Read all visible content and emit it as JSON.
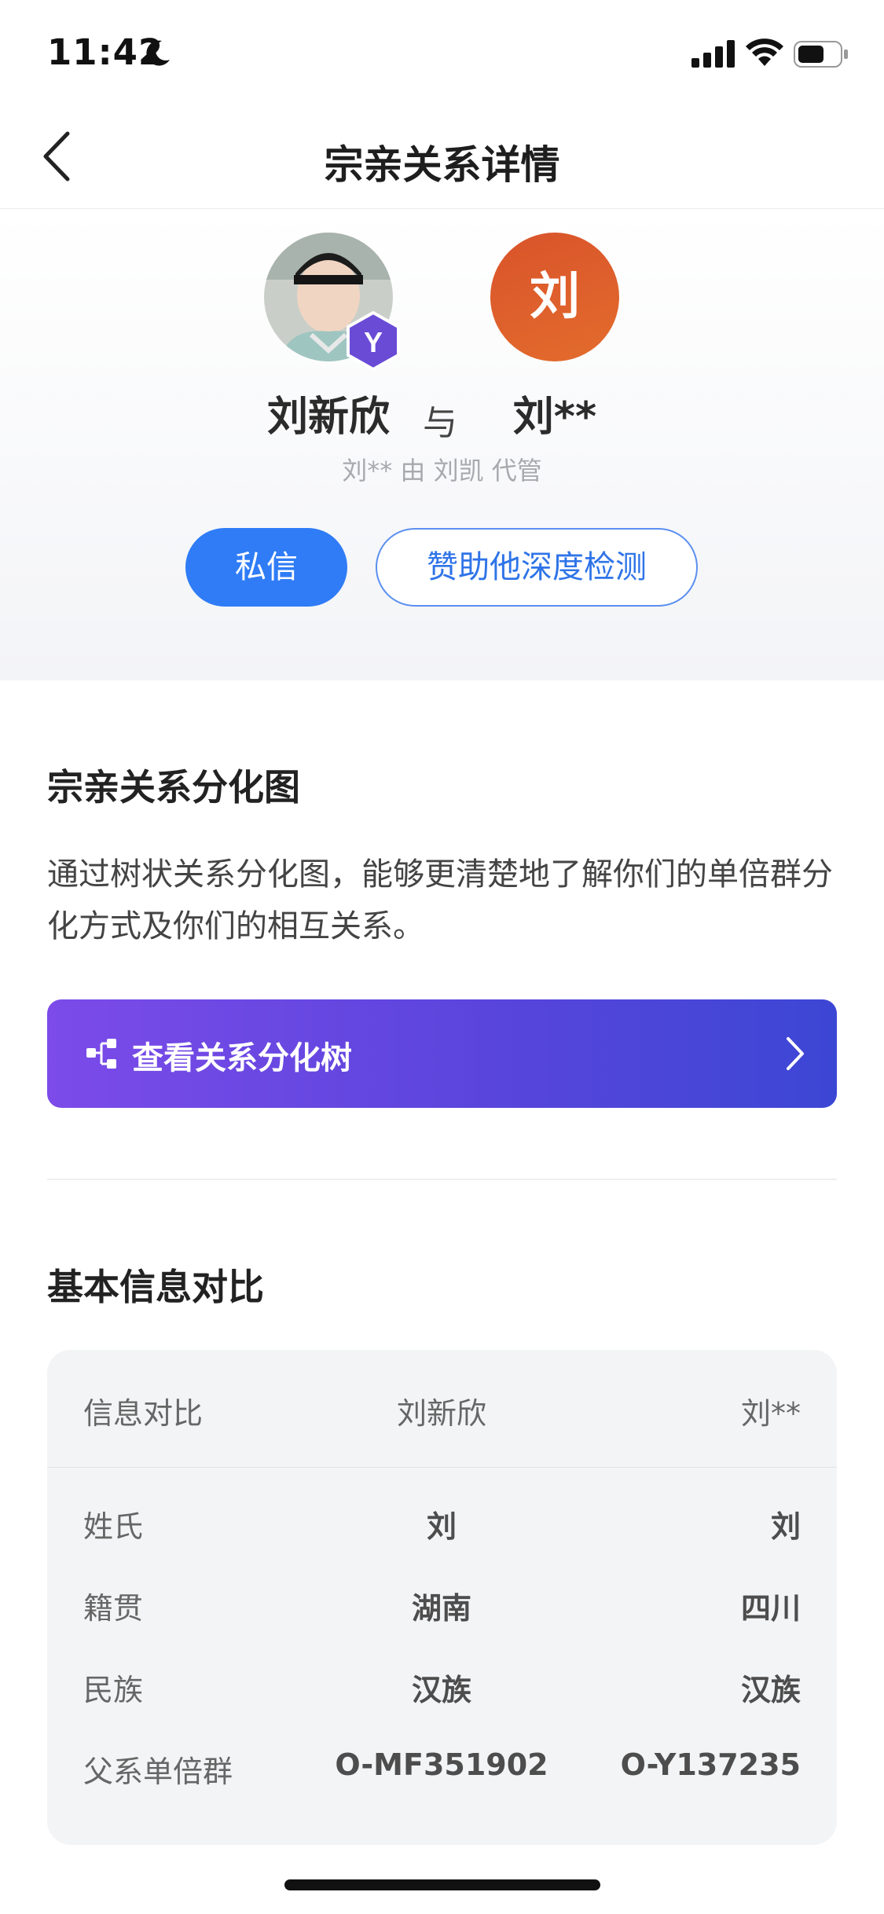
{
  "status_bar": {
    "time": "11:42"
  },
  "nav": {
    "title": "宗亲关系详情"
  },
  "profile": {
    "left_name": "刘新欣",
    "connector": "与",
    "right_name": "刘**",
    "right_avatar_char": "刘",
    "badge_letter": "Y",
    "managed_note": "刘** 由 刘凯 代管",
    "message_button": "私信",
    "sponsor_button": "赞助他深度检测"
  },
  "tree_section": {
    "title": "宗亲关系分化图",
    "description": "通过树状关系分化图，能够更清楚地了解你们的单倍群分化方式及你们的相互关系。",
    "button_label": "查看关系分化树"
  },
  "compare_section": {
    "title": "基本信息对比",
    "headers": [
      "信息对比",
      "刘新欣",
      "刘**"
    ],
    "rows": [
      {
        "label": "姓氏",
        "left": "刘",
        "right": "刘"
      },
      {
        "label": "籍贯",
        "left": "湖南",
        "right": "四川"
      },
      {
        "label": "民族",
        "left": "汉族",
        "right": "汉族"
      },
      {
        "label": "父系单倍群",
        "left": "O-MF351902",
        "right": "O-Y137235"
      }
    ]
  },
  "colors": {
    "primary_blue": "#2f7cf6",
    "tree_button_start": "#7c4be9",
    "tree_button_end": "#3c46d4",
    "avatar_orange": "#dd5e2b",
    "badge_purple": "#6a4bd6"
  }
}
